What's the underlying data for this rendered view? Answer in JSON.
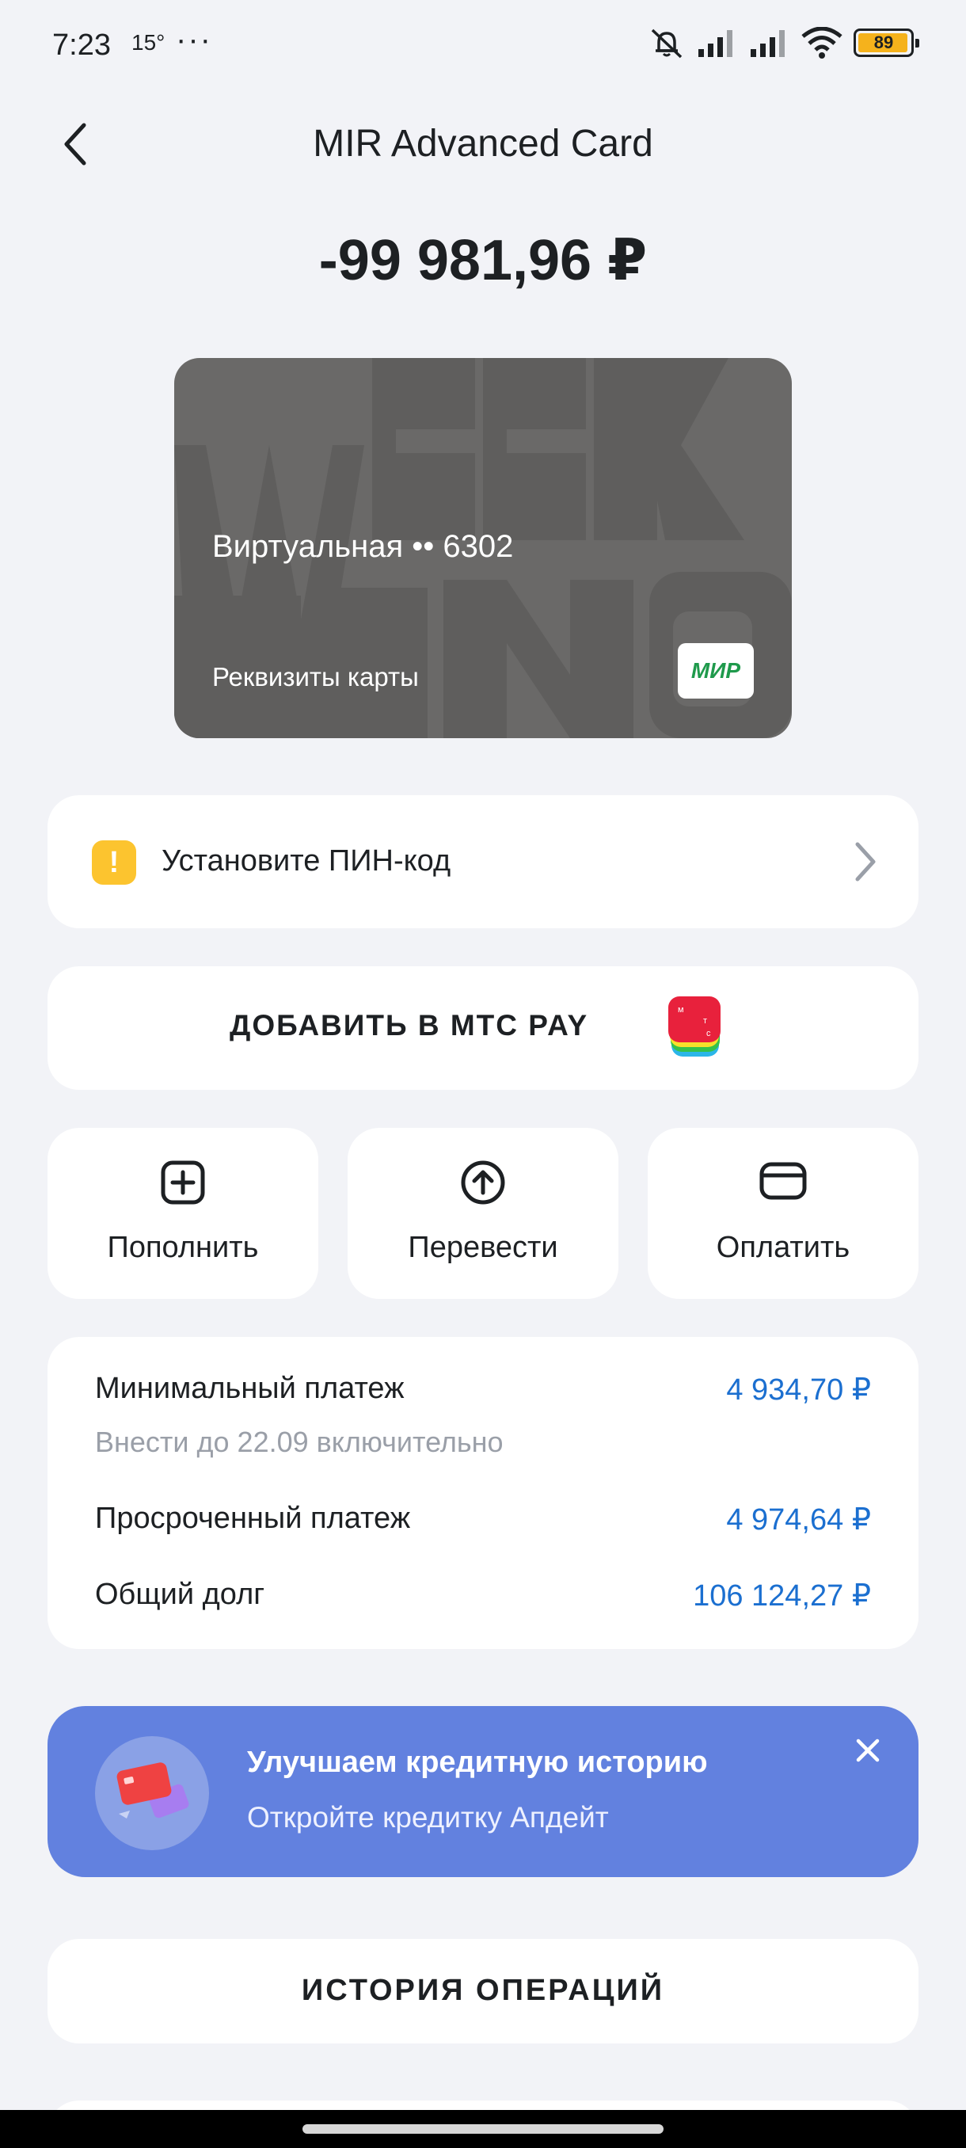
{
  "status_bar": {
    "time": "7:23",
    "temperature": "15°",
    "more": "···",
    "battery": "89",
    "icons": [
      "mute-icon",
      "signal-icon",
      "signal-icon",
      "wifi-icon",
      "battery-icon"
    ]
  },
  "header": {
    "title": "MIR Advanced Card",
    "back_icon": "chevron-left-icon"
  },
  "balance": "-99 981,96 ₽",
  "card": {
    "name": "Виртуальная •• 6302",
    "details_link": "Реквизиты карты",
    "payment_system": "МИР",
    "background_color": "#6a6968"
  },
  "pin_prompt": {
    "badge": "!",
    "text": "Установите ПИН-код"
  },
  "mts_pay": {
    "label": "ДОБАВИТЬ В МТС PAY"
  },
  "actions": [
    {
      "label": "Пополнить",
      "icon": "plus-square-icon"
    },
    {
      "label": "Перевести",
      "icon": "arrow-up-circle-icon"
    },
    {
      "label": "Оплатить",
      "icon": "wallet-icon"
    }
  ],
  "debt": {
    "min_payment_label": "Минимальный платеж",
    "min_payment_value": "4 934,70 ₽",
    "min_payment_note": "Внести до 22.09 включительно",
    "overdue_label": "Просроченный платеж",
    "overdue_value": "4 974,64 ₽",
    "total_label": "Общий долг",
    "total_value": "106 124,27 ₽"
  },
  "promo": {
    "title": "Улучшаем кредитную историю",
    "subtitle": "Откройте кредитку Апдейт",
    "close_icon": "close-icon"
  },
  "history": {
    "label": "ИСТОРИЯ ОПЕРАЦИЙ"
  },
  "colors": {
    "background": "#f2f3f7",
    "accent_blue": "#1b6fd0",
    "promo": "#6281df",
    "warning": "#fcc42f"
  }
}
